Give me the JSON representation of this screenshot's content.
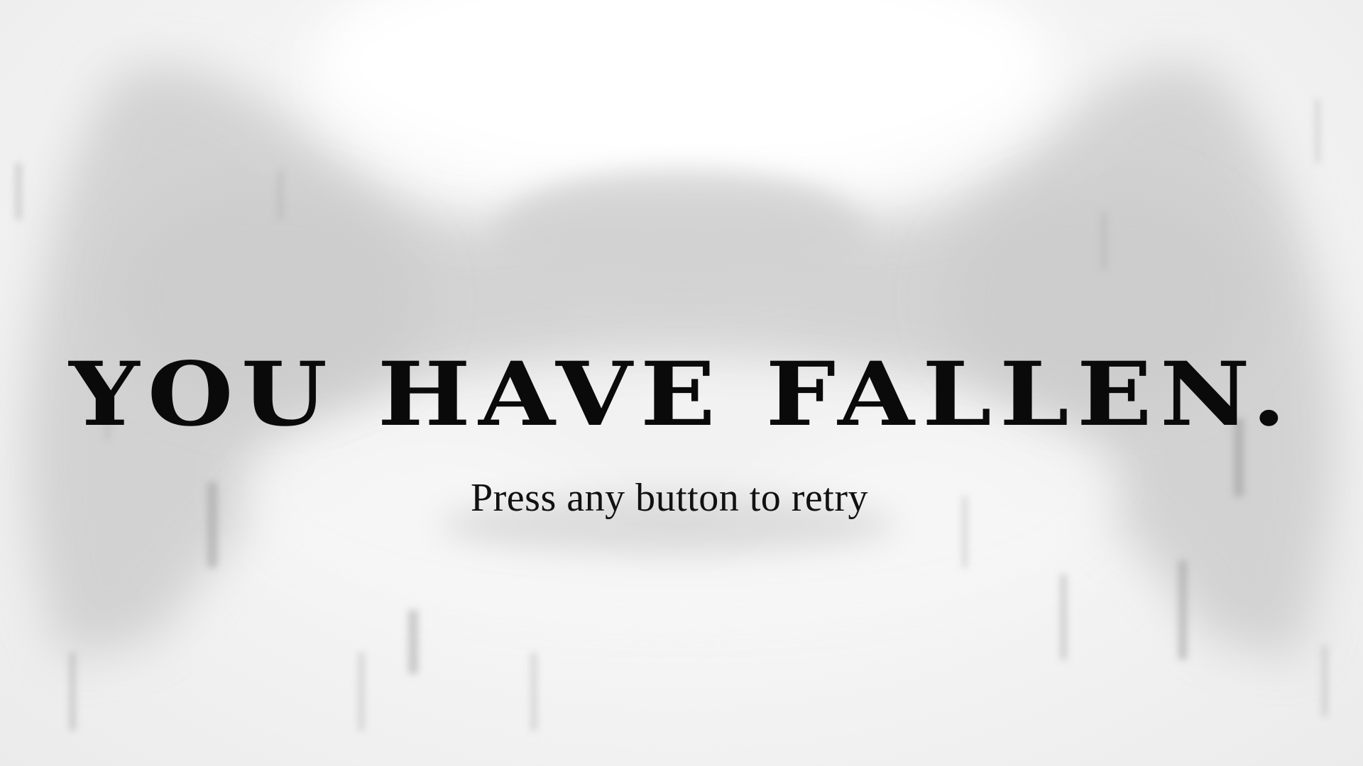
{
  "screen": {
    "title": "YOU HAVE FALLEN.",
    "prompt": "Press any button to retry"
  },
  "colors": {
    "background": "#f4f4f4",
    "silhouette": "#c8c8c8",
    "text": "#0a0a0a"
  }
}
